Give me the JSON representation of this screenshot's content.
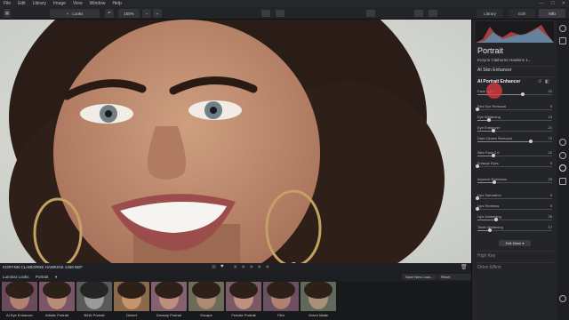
{
  "menu": [
    "File",
    "Edit",
    "Library",
    "Image",
    "View",
    "Window",
    "Help"
  ],
  "toolbar": {
    "looks_label": "Looks",
    "zoom": "100%",
    "zoom_minus": "−",
    "zoom_plus": "+",
    "tabs": [
      "Library",
      "Edit",
      "Info"
    ]
  },
  "status": {
    "filename": "KORYNN CLAIBORNE HAWKINS 1459.NEF",
    "stars": "★ ★ ★ ★ ★"
  },
  "looksbar": {
    "title": "Luminar Looks",
    "category": "Portrait",
    "save_label": "Save New Look...",
    "reset_label": "Reset Adjustments"
  },
  "looks": [
    {
      "label": "AI Eye Enhancer",
      "color": "#6b4a5a"
    },
    {
      "label": "Artistic Portrait",
      "color": "#7a5668"
    },
    {
      "label": "B&W Portrait",
      "color": "#5a5a5a"
    },
    {
      "label": "Desert",
      "color": "#8a6a4a"
    },
    {
      "label": "Dreamy Portrait",
      "color": "#85606e"
    },
    {
      "label": "Escape",
      "color": "#6e6a58"
    },
    {
      "label": "Female Portrait",
      "color": "#7b5a66"
    },
    {
      "label": "Film",
      "color": "#6a5060"
    },
    {
      "label": "Green Matte",
      "color": "#5f6a5a"
    }
  ],
  "panel": {
    "title": "Portrait",
    "subtitle": "Korynn Claiborne Hawkins 1...",
    "sections": [
      "AI Skin Enhancer",
      "AI Portrait Enhancer",
      "Edit Mask",
      "High Key",
      "Orton Effect"
    ],
    "sliders": [
      {
        "label": "Face Light",
        "value": "22",
        "level": 0.61
      },
      {
        "label": "Red Eye Removal",
        "value": "0",
        "level": 0.0
      },
      {
        "label": "Eye Whitening",
        "value": "15",
        "level": 0.15
      },
      {
        "label": "Eye Enhancer",
        "value": "21",
        "level": 0.21
      },
      {
        "label": "Dark Circles Removal",
        "value": "72",
        "level": 0.72
      },
      {
        "label": "Slim Face 2.0",
        "value": "22",
        "level": 0.22
      },
      {
        "label": "Enlarge Eyes",
        "value": "0",
        "level": 0.0
      },
      {
        "label": "Improve Eyebrows",
        "value": "23",
        "level": 0.23
      },
      {
        "label": "Lips Saturation",
        "value": "0",
        "level": 0.0
      },
      {
        "label": "Lips Redness",
        "value": "0",
        "level": 0.0
      },
      {
        "label": "Lips Darkening",
        "value": "25",
        "level": 0.25
      },
      {
        "label": "Teeth Whitening",
        "value": "17",
        "level": 0.17
      }
    ]
  },
  "colors": {
    "accent": "#3d7bd9",
    "cursor": "#e13c3c"
  }
}
